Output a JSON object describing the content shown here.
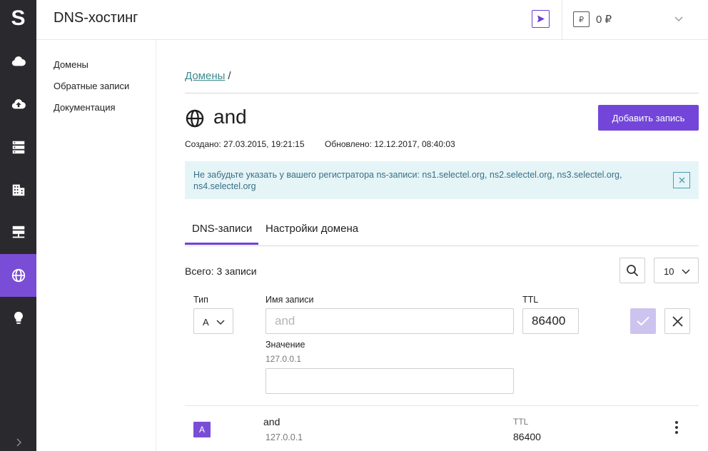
{
  "header": {
    "title": "DNS-хостинг",
    "balance_icon": "₽",
    "balance": "0 ₽"
  },
  "rail": {
    "logo": "S",
    "items": [
      {
        "icon": "cloud-icon"
      },
      {
        "icon": "cloud-upload-icon"
      },
      {
        "icon": "server-stack-icon"
      },
      {
        "icon": "building-icon"
      },
      {
        "icon": "server-network-icon"
      },
      {
        "icon": "globe-icon",
        "active": true
      },
      {
        "icon": "lightbulb-icon"
      }
    ]
  },
  "subnav": {
    "items": [
      {
        "label": "Домены"
      },
      {
        "label": "Обратные записи"
      },
      {
        "label": "Документация"
      }
    ]
  },
  "breadcrumb": {
    "link": "Домены",
    "separator": "/"
  },
  "domain": {
    "name": "and",
    "created": "Создано: 27.03.2015, 19:21:15",
    "updated": "Обновлено: 12.12.2017, 08:40:03",
    "add_button": "Добавить запись"
  },
  "notice": {
    "text": "Не забудьте указать у вашего регистратора ns-записи: ns1.selectel.org, ns2.selectel.org, ns3.selectel.org, ns4.selectel.org"
  },
  "tabs": [
    {
      "label": "DNS-записи",
      "active": true
    },
    {
      "label": "Настройки домена"
    }
  ],
  "records": {
    "total": "Всего: 3 записи",
    "page_size": "10"
  },
  "form": {
    "type_label": "Тип",
    "type_value": "A",
    "name_label": "Имя записи",
    "name_placeholder": "and",
    "ttl_label": "TTL",
    "ttl_value": "86400",
    "value_label": "Значение",
    "value_hint": "127.0.0.1",
    "value_input": ""
  },
  "record_row": {
    "type": "A",
    "name": "and",
    "value": "127.0.0.1",
    "ttl_label": "TTL",
    "ttl": "86400"
  },
  "colors": {
    "accent": "#7346d9",
    "rail_bg": "#2a2a2e",
    "notice_bg": "#e5f4f7",
    "link": "#3a8b8f"
  }
}
